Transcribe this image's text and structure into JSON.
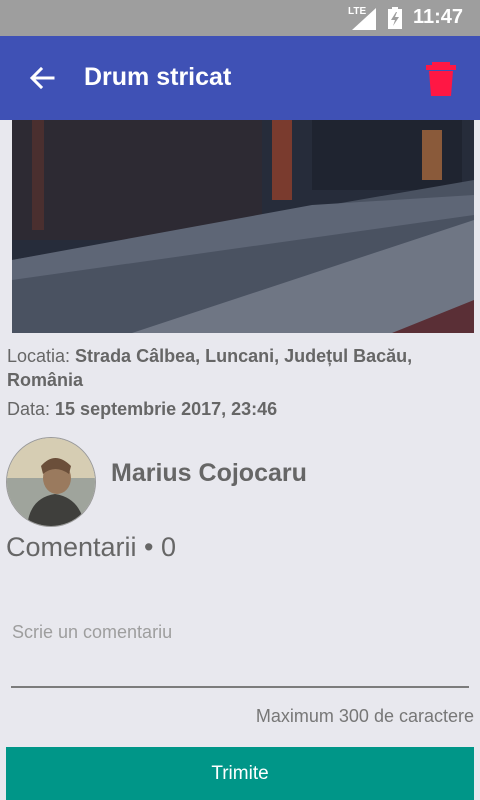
{
  "status_bar": {
    "network": "LTE",
    "time": "11:47"
  },
  "app_bar": {
    "title": "Drum stricat",
    "back_icon": "arrow-left-icon",
    "delete_icon": "trash-icon",
    "delete_color": "#ff1744",
    "bar_color": "#3f51b5"
  },
  "report": {
    "location_label": "Locatia: ",
    "location_value": "Strada Câlbea, Luncani, Județul Bacău, România",
    "date_label": "Data: ",
    "date_value": "15 septembrie 2017, 23:46"
  },
  "author": {
    "name": "Marius Cojocaru"
  },
  "comments": {
    "title": "Comentarii • 0",
    "input_placeholder": "Scrie un comentariu",
    "max_label": "Maximum 300 de caractere",
    "send_label": "Trimite",
    "send_color": "#009688"
  }
}
